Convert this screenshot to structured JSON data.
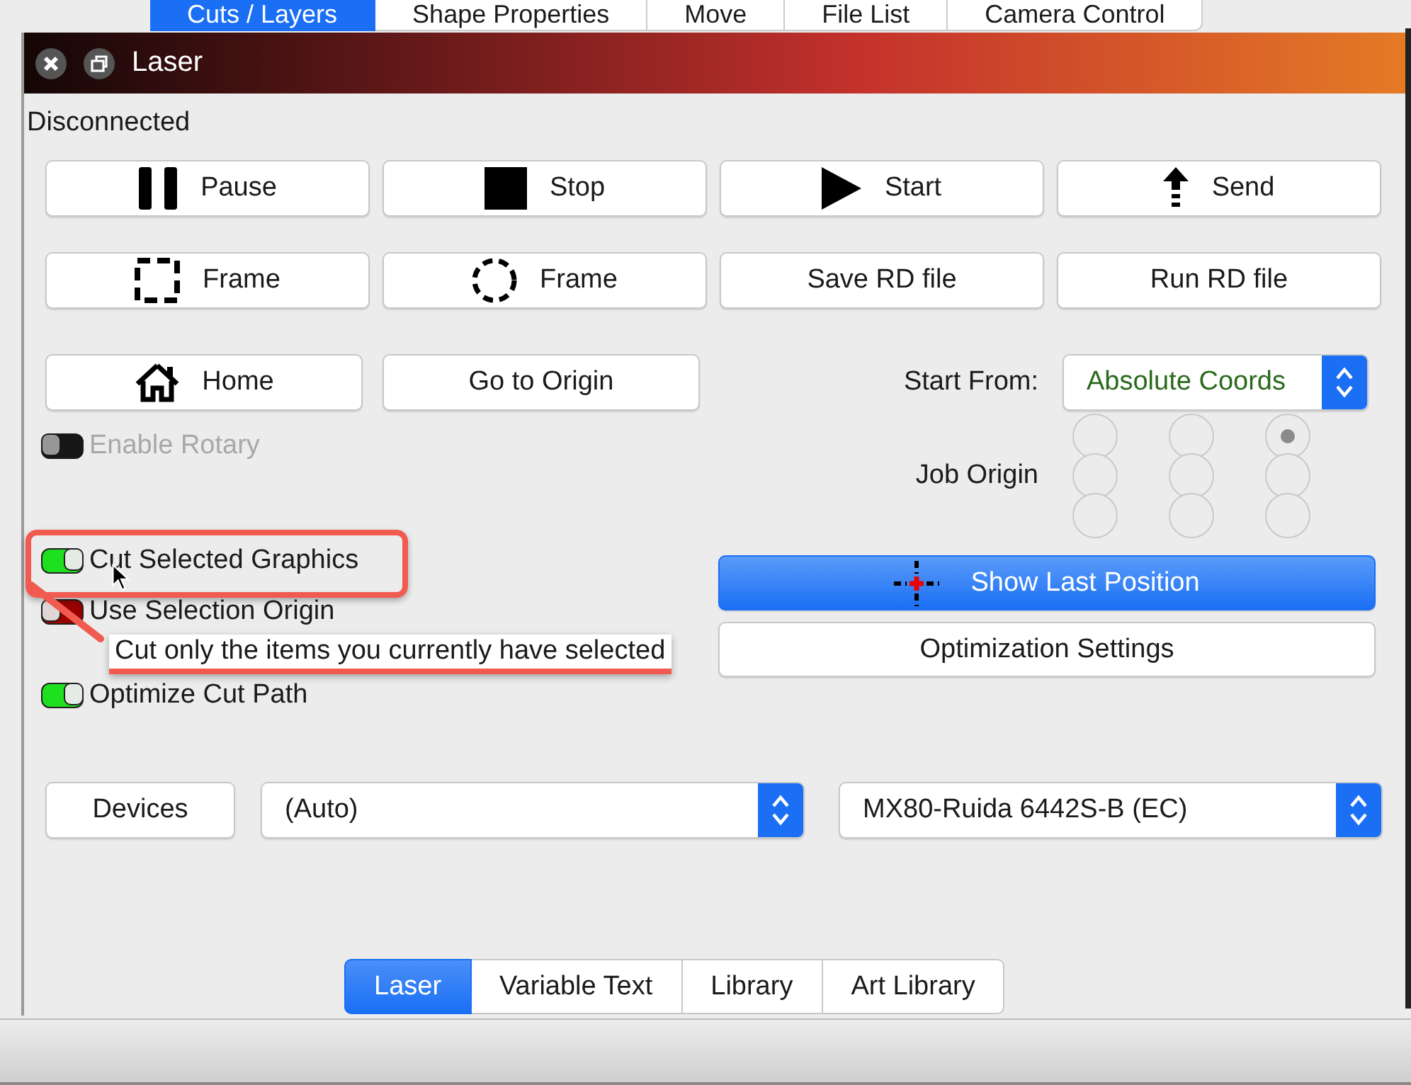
{
  "top_tabs": [
    {
      "label": "Cuts / Layers",
      "selected": true
    },
    {
      "label": "Shape Properties",
      "selected": false
    },
    {
      "label": "Move",
      "selected": false
    },
    {
      "label": "File List",
      "selected": false
    },
    {
      "label": "Camera Control",
      "selected": false
    }
  ],
  "window": {
    "title": "Laser"
  },
  "status": "Disconnected",
  "buttons": [
    {
      "label": "Pause",
      "kind": "pause"
    },
    {
      "label": "Stop",
      "kind": "stop"
    },
    {
      "label": "Start",
      "kind": "play"
    },
    {
      "label": "Send",
      "kind": "send"
    },
    {
      "label": "Frame",
      "kind": "frame"
    },
    {
      "label": "Frame",
      "kind": "circle-frame"
    },
    {
      "label": "Save RD file",
      "kind": "plain"
    },
    {
      "label": "Run RD file",
      "kind": "plain"
    },
    {
      "label": "Home",
      "kind": "home"
    },
    {
      "label": "Go to Origin",
      "kind": "plain"
    }
  ],
  "start_from": {
    "label": "Start From:",
    "value": "Absolute Coords"
  },
  "options": [
    {
      "label": "Enable Rotary",
      "on": false,
      "disabled": true
    },
    {
      "label": "Cut Selected Graphics",
      "on": true,
      "disabled": false
    },
    {
      "label": "Use Selection Origin",
      "on": false,
      "disabled": false
    },
    {
      "label": "Optimize Cut Path",
      "on": true,
      "disabled": false
    }
  ],
  "job_origin": {
    "label": "Job Origin",
    "points": [
      {
        "selected": false
      },
      {
        "selected": false
      },
      {
        "selected": true
      },
      {
        "selected": false
      },
      {
        "selected": false
      },
      {
        "selected": false
      },
      {
        "selected": false
      },
      {
        "selected": false
      },
      {
        "selected": false
      }
    ]
  },
  "show_last_position": "Show Last Position",
  "optimization_settings": "Optimization Settings",
  "devices": {
    "button": "Devices",
    "port": "(Auto)",
    "device": "MX80-Ruida 6442S-B (EC)"
  },
  "tooltip": "Cut only the items you currently have selected",
  "bottom_tabs": [
    {
      "label": "Laser",
      "selected": true
    },
    {
      "label": "Variable Text",
      "selected": false
    },
    {
      "label": "Library",
      "selected": false
    },
    {
      "label": "Art Library",
      "selected": false
    }
  ]
}
